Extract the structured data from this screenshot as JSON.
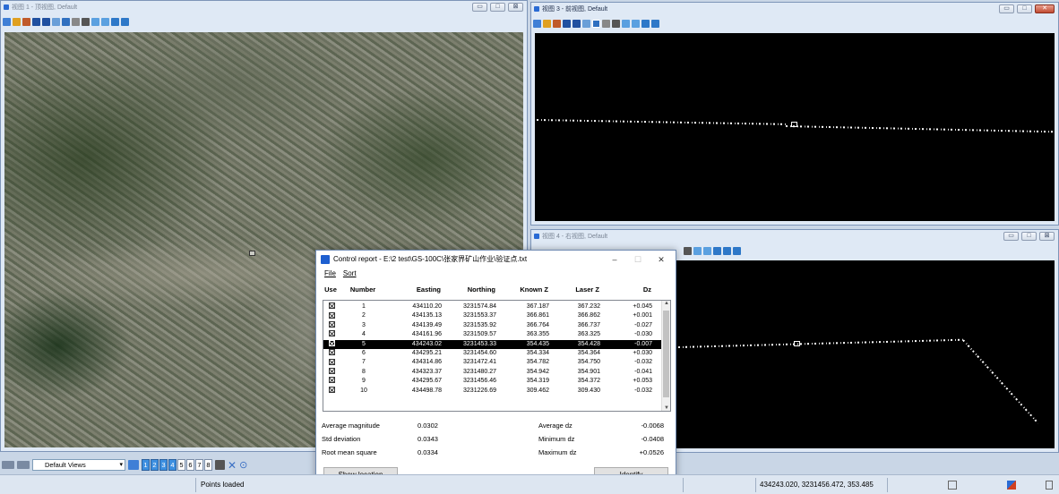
{
  "views": {
    "top": {
      "title": "视图 1 - 顶视图, Default",
      "controls": [
        "▭",
        "□",
        "⊠"
      ]
    },
    "front": {
      "title": "视图 3 - 前视图, Default",
      "controls": [
        "▭",
        "□",
        "✕"
      ]
    },
    "right": {
      "title": "视图 4 - 右视图, Default",
      "controls": [
        "▭",
        "□",
        "⊠"
      ]
    }
  },
  "dialog": {
    "title": "Control report - E:\\2 test\\GS-100C\\张家界矿山作业\\验证点.txt",
    "controls": {
      "minimize": "–",
      "maximize": "☐",
      "close": "✕"
    },
    "menu": {
      "file": "File",
      "sort": "Sort"
    },
    "columns": {
      "use": "Use",
      "number": "Number",
      "easting": "Easting",
      "northing": "Northing",
      "known_z": "Known Z",
      "laser_z": "Laser Z",
      "dz": "Dz"
    },
    "rows": [
      {
        "number": "1",
        "easting": "434110.20",
        "northing": "3231574.84",
        "known_z": "367.187",
        "laser_z": "367.232",
        "dz": "+0.045"
      },
      {
        "number": "2",
        "easting": "434135.13",
        "northing": "3231553.37",
        "known_z": "366.861",
        "laser_z": "366.862",
        "dz": "+0.001"
      },
      {
        "number": "3",
        "easting": "434139.49",
        "northing": "3231535.92",
        "known_z": "366.764",
        "laser_z": "366.737",
        "dz": "-0.027"
      },
      {
        "number": "4",
        "easting": "434161.96",
        "northing": "3231509.57",
        "known_z": "363.355",
        "laser_z": "363.325",
        "dz": "-0.030"
      },
      {
        "number": "5",
        "easting": "434243.02",
        "northing": "3231453.33",
        "known_z": "354.435",
        "laser_z": "354.428",
        "dz": "-0.007"
      },
      {
        "number": "6",
        "easting": "434295.21",
        "northing": "3231454.60",
        "known_z": "354.334",
        "laser_z": "354.364",
        "dz": "+0.030"
      },
      {
        "number": "7",
        "easting": "434314.86",
        "northing": "3231472.41",
        "known_z": "354.782",
        "laser_z": "354.750",
        "dz": "-0.032"
      },
      {
        "number": "8",
        "easting": "434323.37",
        "northing": "3231480.27",
        "known_z": "354.942",
        "laser_z": "354.901",
        "dz": "-0.041"
      },
      {
        "number": "9",
        "easting": "434295.67",
        "northing": "3231456.46",
        "known_z": "354.319",
        "laser_z": "354.372",
        "dz": "+0.053"
      },
      {
        "number": "10",
        "easting": "434498.78",
        "northing": "3231226.69",
        "known_z": "309.462",
        "laser_z": "309.430",
        "dz": "-0.032"
      }
    ],
    "selected_row": 5,
    "stats": {
      "avg_mag_label": "Average magnitude",
      "avg_mag": "0.0302",
      "std_label": "Std deviation",
      "std": "0.0343",
      "rms_label": "Root mean square",
      "rms": "0.0334",
      "avg_dz_label": "Average dz",
      "avg_dz": "-0.0068",
      "min_dz_label": "Minimum dz",
      "min_dz": "-0.0408",
      "max_dz_label": "Maximum dz",
      "max_dz": "+0.0526"
    },
    "buttons": {
      "show_location": "Show location",
      "identify": "Identify"
    }
  },
  "viewbar": {
    "default_views": "Default Views",
    "view_numbers": [
      "1",
      "2",
      "3",
      "4",
      "5",
      "6",
      "7",
      "8"
    ],
    "active_views": [
      "1",
      "2",
      "3",
      "4"
    ]
  },
  "status": {
    "message": "Points loaded",
    "coordinates": "434243.020, 3231456.472, 353.485"
  },
  "colors": {
    "selected_row": "#000000",
    "accent": "#2a6bd4",
    "close_button": "#c24a31"
  }
}
